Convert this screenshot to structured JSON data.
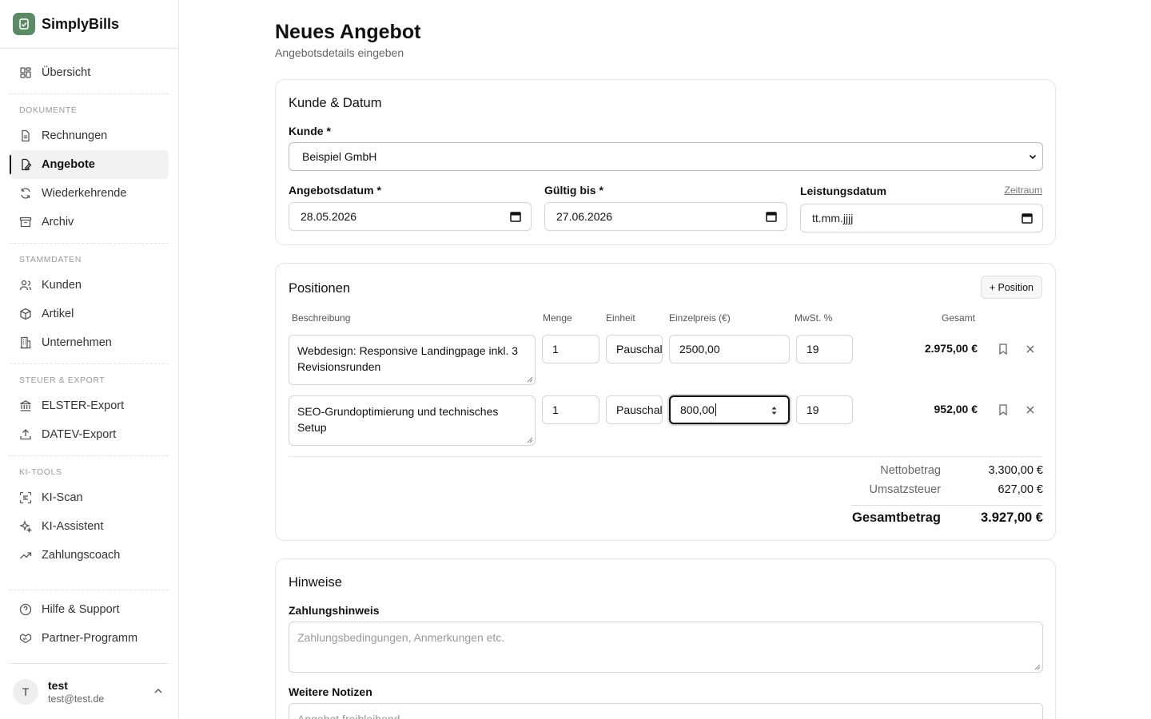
{
  "app": {
    "name": "SimplyBills"
  },
  "sidebar": {
    "overview": "Übersicht",
    "sections": [
      {
        "heading": "DOKUMENTE",
        "items": [
          "Rechnungen",
          "Angebote",
          "Wiederkehrende",
          "Archiv"
        ]
      },
      {
        "heading": "STAMMDATEN",
        "items": [
          "Kunden",
          "Artikel",
          "Unternehmen"
        ]
      },
      {
        "heading": "STEUER & EXPORT",
        "items": [
          "ELSTER-Export",
          "DATEV-Export"
        ]
      },
      {
        "heading": "KI-TOOLS",
        "items": [
          "KI-Scan",
          "KI-Assistent",
          "Zahlungscoach"
        ]
      }
    ],
    "footer_items": [
      "Hilfe & Support",
      "Partner-Programm"
    ],
    "user": {
      "initial": "T",
      "name": "test",
      "email": "test@test.de"
    }
  },
  "page": {
    "title": "Neues Angebot",
    "subtitle": "Angebotsdetails eingeben"
  },
  "customer_card": {
    "title": "Kunde & Datum",
    "customer_label": "Kunde *",
    "customer_value": "Beispiel GmbH",
    "offer_date_label": "Angebotsdatum *",
    "offer_date_value": "28.05.2026",
    "valid_until_label": "Gültig bis *",
    "valid_until_value": "27.06.2026",
    "service_date_label": "Leistungsdatum",
    "service_date_value": "tt.mm.jjjj",
    "period_link": "Zeitraum"
  },
  "positions": {
    "title": "Positionen",
    "add_button": "+ Position",
    "columns": {
      "description": "Beschreibung",
      "quantity": "Menge",
      "unit": "Einheit",
      "unit_price": "Einzelpreis (€)",
      "vat": "MwSt. %",
      "total": "Gesamt"
    },
    "rows": [
      {
        "description": "Webdesign: Responsive Landingpage inkl. 3 Revisionsrunden",
        "quantity": "1",
        "unit": "Pauschal",
        "unit_price": "2500,00",
        "vat": "19",
        "total": "2.975,00 €"
      },
      {
        "description": "SEO-Grundoptimierung und technisches Setup",
        "quantity": "1",
        "unit": "Pauschal",
        "unit_price": "800,00",
        "vat": "19",
        "total": "952,00 €"
      }
    ],
    "summary": {
      "net_label": "Nettobetrag",
      "net_value": "3.300,00 €",
      "vat_label": "Umsatzsteuer",
      "vat_value": "627,00 €",
      "gross_label": "Gesamtbetrag",
      "gross_value": "3.927,00 €"
    }
  },
  "notes": {
    "title": "Hinweise",
    "payment_label": "Zahlungshinweis",
    "payment_placeholder": "Zahlungsbedingungen, Anmerkungen etc.",
    "notes_label": "Weitere Notizen",
    "notes_placeholder": "Angebot freibleibend"
  }
}
